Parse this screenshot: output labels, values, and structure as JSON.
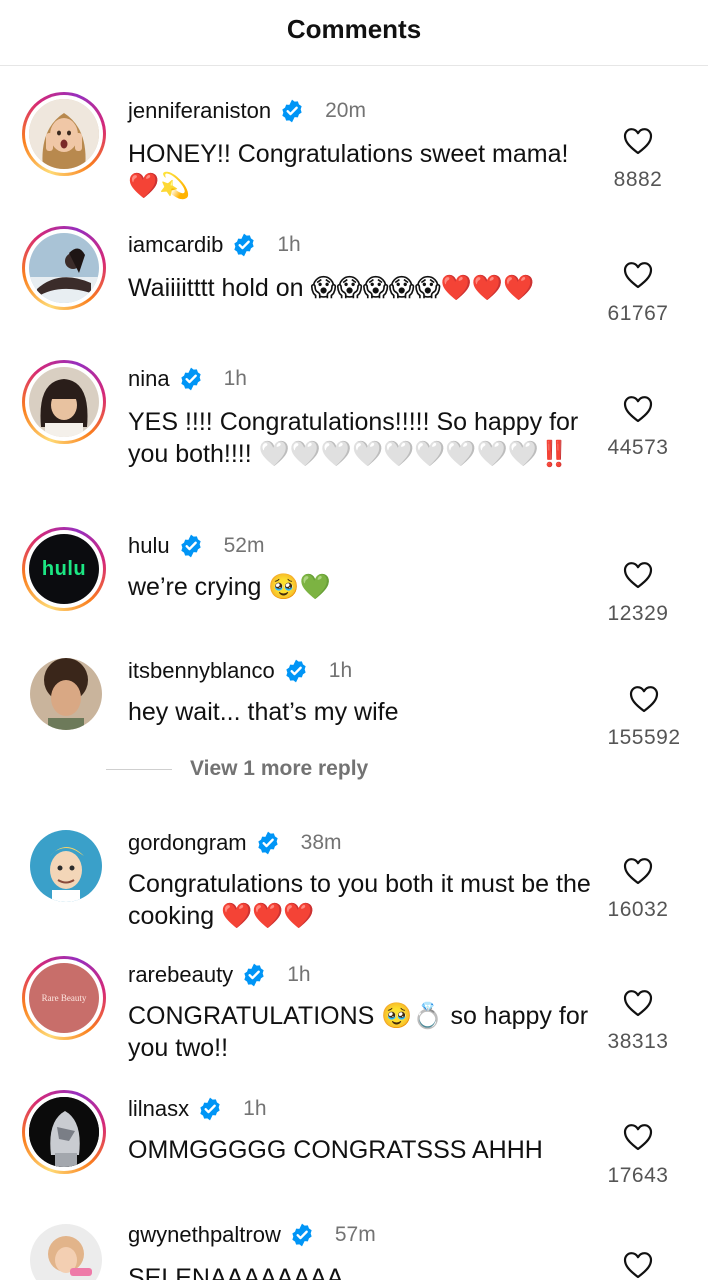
{
  "header": {
    "title": "Comments"
  },
  "comments": [
    {
      "username": "jenniferaniston",
      "time": "20m",
      "text": "HONEY!! Congratulations sweet mama! ❤️💫",
      "likes": "8882",
      "avatar": "photo-woman-surprised"
    },
    {
      "username": "iamcardib",
      "time": "1h",
      "text": "Waiiiitttt hold on 😱😱😱😱😱❤️❤️❤️",
      "likes": "61767",
      "avatar": "photo-woman-reclining"
    },
    {
      "username": "nina",
      "time": "1h",
      "text": "YES !!!! Congratulations!!!!! So happy for you both!!!! 🤍🤍🤍🤍🤍🤍🤍🤍🤍‼️",
      "likes": "44573",
      "avatar": "photo-girl-dark-hair"
    },
    {
      "username": "hulu",
      "time": "52m",
      "text": "we’re crying 🥹💚",
      "likes": "12329",
      "avatar": "hulu-logo",
      "logo_text": "hulu"
    },
    {
      "username": "itsbennyblanco",
      "time": "1h",
      "text": "hey wait... that’s my wife",
      "likes": "155592",
      "avatar": "photo-man-curly-hair"
    },
    {
      "username": "gordongram",
      "time": "38m",
      "text": "Congratulations to you both it must be the cooking ❤️❤️❤️",
      "likes": "16032",
      "avatar": "cartoon-chef"
    },
    {
      "username": "rarebeauty",
      "time": "1h",
      "text": "CONGRATULATIONS 🥹💍 so happy for you two!!",
      "likes": "38313",
      "avatar": "rare-beauty-logo",
      "logo_text": "Rare Beauty"
    },
    {
      "username": "lilnasx",
      "time": "1h",
      "text": "OMMGGGGG CONGRATSSS AHHH",
      "likes": "17643",
      "avatar": "photo-silver-helmet"
    },
    {
      "username": "gwynethpaltrow",
      "time": "57m",
      "text": "SELENAAAAAAAA",
      "likes": "",
      "avatar": "photo-woman-blonde"
    }
  ],
  "view_more": {
    "label": "View 1 more reply"
  },
  "icons": {
    "verified": "verified-badge-icon",
    "like": "heart-outline-icon"
  },
  "colors": {
    "verified": "#0095f6",
    "muted": "#737373",
    "hulu_green": "#1ce783"
  }
}
